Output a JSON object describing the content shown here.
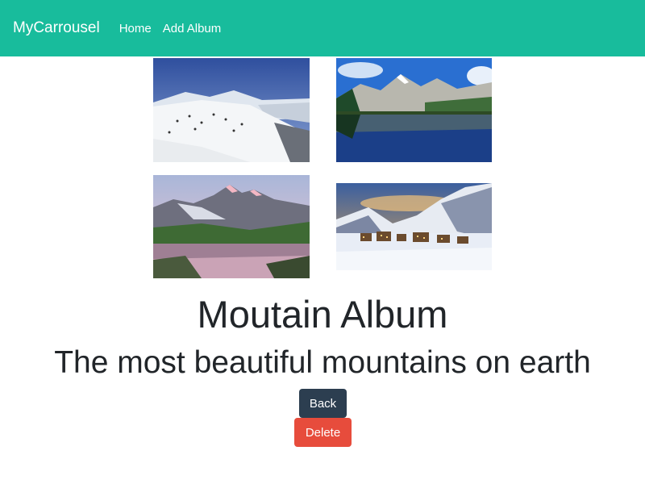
{
  "navbar": {
    "brand": "MyCarrousel",
    "links": [
      "Home",
      "Add Album"
    ],
    "background": "#18bc9c"
  },
  "album": {
    "images": [
      {
        "description": "snowy ski slope with people"
      },
      {
        "description": "mountain lake reflection with pine forest"
      },
      {
        "description": "pink sunset mountains over a lake"
      },
      {
        "description": "snowy mountain village at dusk"
      }
    ],
    "title": "Moutain Album",
    "description": "The most beautiful mountains on earth"
  },
  "actions": {
    "back_label": "Back",
    "back_color": "#2c3e50",
    "delete_label": "Delete",
    "delete_color": "#e74c3c"
  }
}
